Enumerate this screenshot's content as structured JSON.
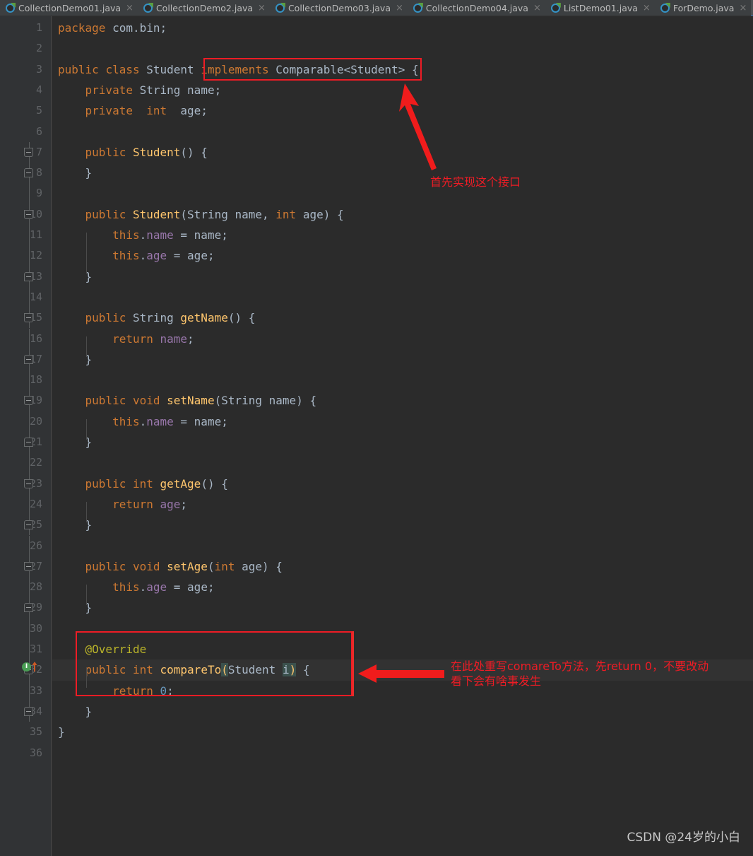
{
  "window": {
    "app": "IntelliJ IDEA Java editor",
    "watermark": "CSDN @24岁的小白"
  },
  "tabs": [
    {
      "label": "CollectionDemo01.java",
      "icon": "java-class-icon",
      "close": "×",
      "active": false
    },
    {
      "label": "CollectionDemo2.java",
      "icon": "java-class-icon",
      "close": "×",
      "active": false
    },
    {
      "label": "CollectionDemo03.java",
      "icon": "java-class-icon",
      "close": "×",
      "active": false
    },
    {
      "label": "CollectionDemo04.java",
      "icon": "java-class-icon",
      "close": "×",
      "active": false
    },
    {
      "label": "ListDemo01.java",
      "icon": "java-class-icon",
      "close": "×",
      "active": false
    },
    {
      "label": "ForDemo.java",
      "icon": "java-class-icon",
      "close": "×",
      "active": false
    },
    {
      "label": "",
      "icon": "java-class-icon",
      "close": "",
      "active": true
    }
  ],
  "editor": {
    "gutter_icons": {
      "override_marker": "I",
      "override_marker_title": "implementing-method-indicator"
    },
    "lines": [
      {
        "n": "1",
        "text": "package com.bin;"
      },
      {
        "n": "2",
        "text": ""
      },
      {
        "n": "3",
        "text": "public class Student implements Comparable<Student> {"
      },
      {
        "n": "4",
        "text": "    private String name;"
      },
      {
        "n": "5",
        "text": "    private  int  age;"
      },
      {
        "n": "6",
        "text": ""
      },
      {
        "n": "7",
        "text": "    public Student() {"
      },
      {
        "n": "8",
        "text": "    }"
      },
      {
        "n": "9",
        "text": ""
      },
      {
        "n": "10",
        "text": "    public Student(String name, int age) {"
      },
      {
        "n": "11",
        "text": "        this.name = name;"
      },
      {
        "n": "12",
        "text": "        this.age = age;"
      },
      {
        "n": "13",
        "text": "    }"
      },
      {
        "n": "14",
        "text": ""
      },
      {
        "n": "15",
        "text": "    public String getName() {"
      },
      {
        "n": "16",
        "text": "        return name;"
      },
      {
        "n": "17",
        "text": "    }"
      },
      {
        "n": "18",
        "text": ""
      },
      {
        "n": "19",
        "text": "    public void setName(String name) {"
      },
      {
        "n": "20",
        "text": "        this.name = name;"
      },
      {
        "n": "21",
        "text": "    }"
      },
      {
        "n": "22",
        "text": ""
      },
      {
        "n": "23",
        "text": "    public int getAge() {"
      },
      {
        "n": "24",
        "text": "        return age;"
      },
      {
        "n": "25",
        "text": "    }"
      },
      {
        "n": "26",
        "text": ""
      },
      {
        "n": "27",
        "text": "    public void setAge(int age) {"
      },
      {
        "n": "28",
        "text": "        this.age = age;"
      },
      {
        "n": "29",
        "text": "    }"
      },
      {
        "n": "30",
        "text": ""
      },
      {
        "n": "31",
        "text": "    @Override"
      },
      {
        "n": "32",
        "text": "    public int compareTo(Student i) {"
      },
      {
        "n": "33",
        "text": "        return 0;"
      },
      {
        "n": "34",
        "text": "    }"
      },
      {
        "n": "35",
        "text": "}"
      },
      {
        "n": "36",
        "text": ""
      }
    ]
  },
  "annotations": [
    {
      "id": "implements-callout",
      "text": "首先实现这个接口",
      "target": "implements Comparable<Student>"
    },
    {
      "id": "compareto-callout",
      "line1": "在此处重写comareTo方法，先return 0，不要改动",
      "line2": "看下会有啥事发生",
      "target": "@Override public int compareTo(Student i) { return 0;"
    }
  ],
  "colors": {
    "editor_bg": "#2b2b2b",
    "gutter_bg": "#313335",
    "tab_bg": "#3c3f41",
    "tab_active_bg": "#4e5254",
    "tab_underline": "#4a88c7",
    "keyword": "#cc7832",
    "method": "#ffc66d",
    "field": "#9876aa",
    "number": "#6897bb",
    "annotation": "#bbb529",
    "text": "#a9b7c6",
    "callout_red": "#ee1c25"
  }
}
